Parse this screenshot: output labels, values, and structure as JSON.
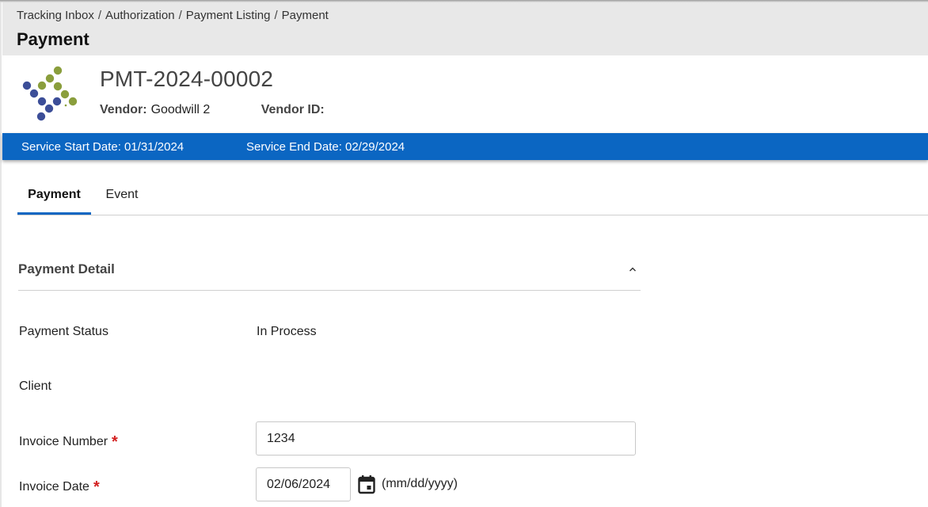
{
  "breadcrumb": [
    "Tracking Inbox",
    "Authorization",
    "Payment Listing",
    "Payment"
  ],
  "breadcrumb_separator": "/",
  "page_title": "Payment",
  "record": {
    "id": "PMT-2024-00002",
    "vendor_label": "Vendor:",
    "vendor_value": "Goodwill 2",
    "vendor_id_label": "Vendor ID:",
    "vendor_id_value": ""
  },
  "logo": {
    "name": "organization-logo",
    "colors": {
      "green": "#8a9e3c",
      "blue": "#3c4e98"
    }
  },
  "service_band": {
    "start": "Service Start Date: 01/31/2024",
    "end": "Service End Date: 02/29/2024",
    "color": "#0b66c2"
  },
  "tabs": [
    {
      "label": "Payment",
      "active": true
    },
    {
      "label": "Event",
      "active": false
    }
  ],
  "section": {
    "title": "Payment Detail",
    "expanded": true,
    "collapse_icon": "chevron-up-icon"
  },
  "fields": {
    "payment_status": {
      "label": "Payment Status",
      "value": "In Process"
    },
    "client": {
      "label": "Client",
      "value": ""
    },
    "invoice_number": {
      "label": "Invoice Number",
      "required": "*",
      "value": "1234"
    },
    "invoice_date": {
      "label": "Invoice Date",
      "required": "*",
      "value": "02/06/2024",
      "hint": "(mm/dd/yyyy)",
      "icon": "calendar-icon"
    }
  }
}
